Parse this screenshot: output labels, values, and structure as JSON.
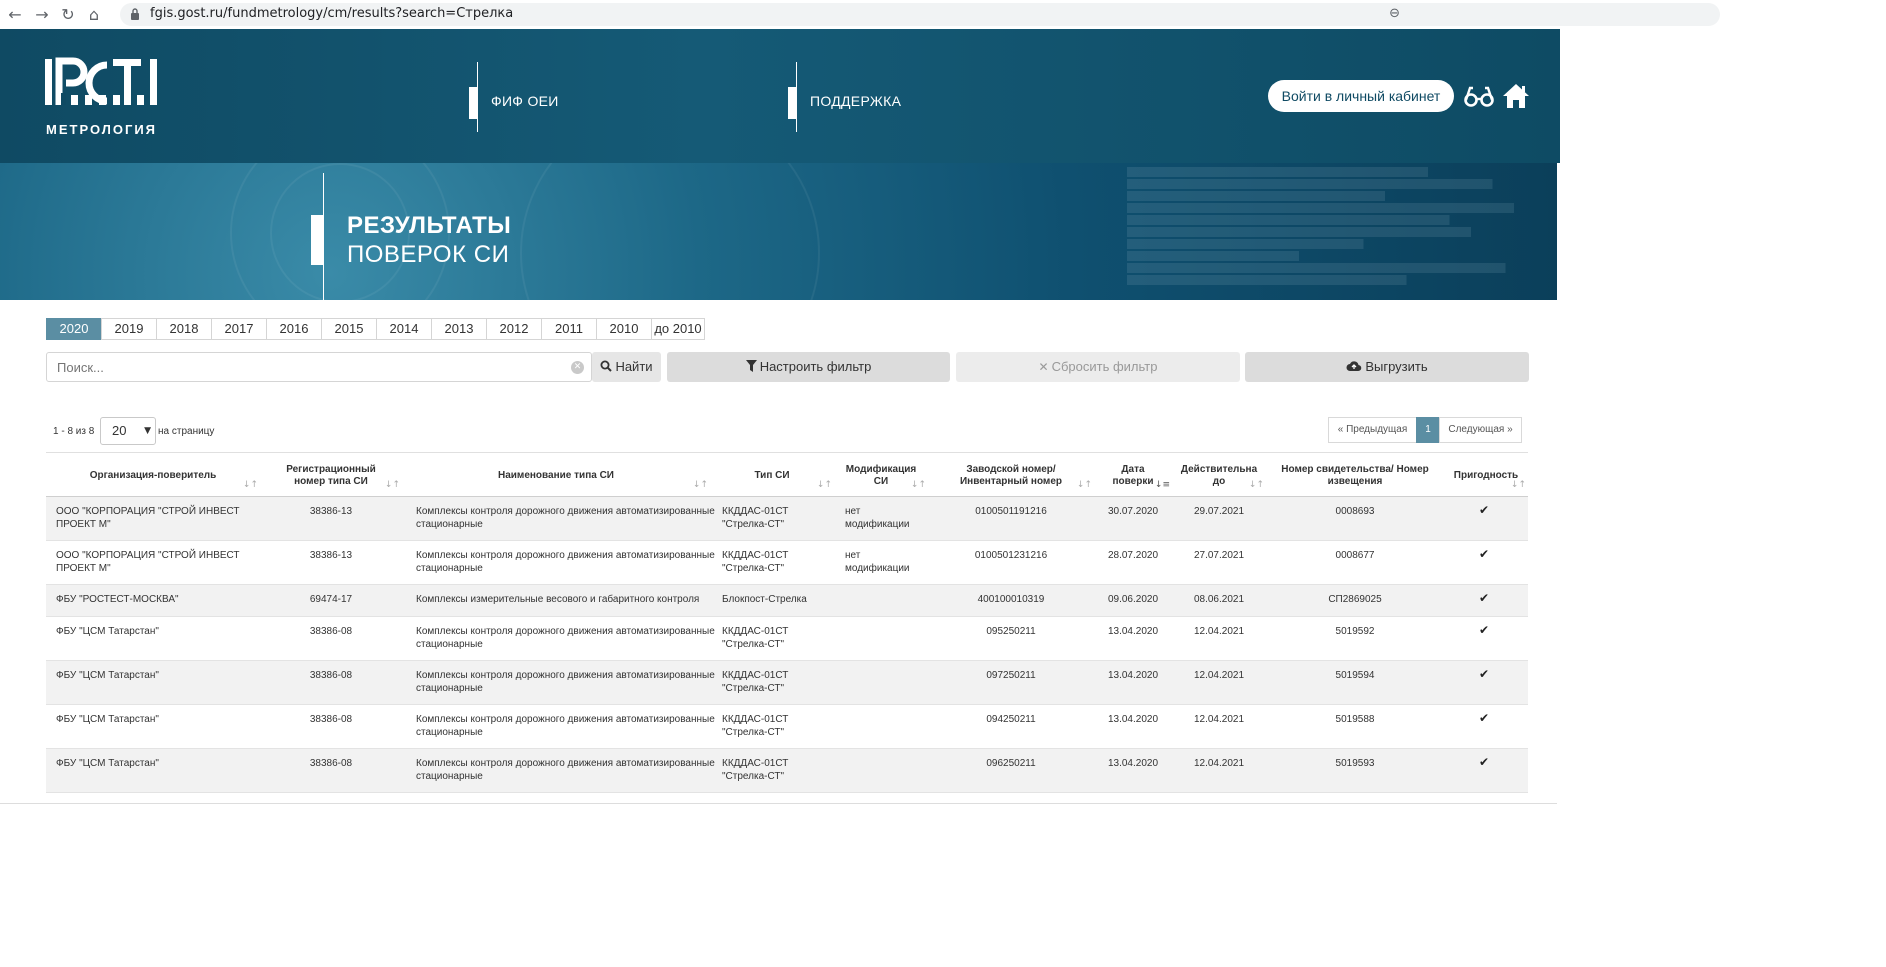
{
  "browser": {
    "url_text": "fgis.gost.ru/fundmetrology/cm/results?search=Стрелка",
    "back_glyph": "←",
    "forward_glyph": "→",
    "reload_glyph": "↻",
    "home_glyph": "⌂",
    "zoom_glyph": "⊖"
  },
  "header": {
    "logo_text": "МЕТРОЛОГИЯ",
    "menu": [
      "ФИФ ОЕИ",
      "ПОДДЕРЖКА"
    ],
    "login_label": "Войти в личный кабинет"
  },
  "banner": {
    "title": "РЕЗУЛЬТАТЫ",
    "subtitle": "ПОВЕРОК СИ"
  },
  "years": {
    "active": "2020",
    "items": [
      "2020",
      "2019",
      "2018",
      "2017",
      "2016",
      "2015",
      "2014",
      "2013",
      "2012",
      "2011",
      "2010",
      "до 2010"
    ]
  },
  "search": {
    "placeholder": "Поиск...",
    "find_label": "Найти",
    "filter_label": "Настроить фильтр",
    "reset_label": "Сбросить фильтр",
    "export_label": "Выгрузить"
  },
  "paging": {
    "range_text": "1 - 8 из 8",
    "per_page_value": "20",
    "per_page_label": "на страницу",
    "prev_label": "« Предыдущая",
    "current_page": "1",
    "next_label": "Следующая »"
  },
  "table": {
    "columns": [
      "Организация-поверитель",
      "Регистрационный номер типа СИ",
      "Наименование типа СИ",
      "Тип СИ",
      "Модификация СИ",
      "Заводской номер/ Инвентарный номер",
      "Дата поверки",
      "Действительна до",
      "Номер свидетельства/ Номер извещения",
      "Пригодность"
    ],
    "rows": [
      {
        "org": "ООО \"КОРПОРАЦИЯ \"СТРОЙ ИНВЕСТ ПРОЕКТ М\"",
        "reg": "38386-13",
        "name": "Комплексы контроля дорожного движения автоматизированные стационарные",
        "type": "ККДДАС-01СТ \"Стрелка-СТ\"",
        "mod": "нет модификации",
        "serial": "0100501191216",
        "date": "30.07.2020",
        "valid": "29.07.2021",
        "cert": "0008693",
        "ok": "✔"
      },
      {
        "org": "ООО \"КОРПОРАЦИЯ \"СТРОЙ ИНВЕСТ ПРОЕКТ М\"",
        "reg": "38386-13",
        "name": "Комплексы контроля дорожного движения автоматизированные стационарные",
        "type": "ККДДАС-01СТ \"Стрелка-СТ\"",
        "mod": "нет модификации",
        "serial": "0100501231216",
        "date": "28.07.2020",
        "valid": "27.07.2021",
        "cert": "0008677",
        "ok": "✔"
      },
      {
        "org": "ФБУ \"РОСТЕСТ-МОСКВА\"",
        "reg": "69474-17",
        "name": "Комплексы измерительные весового и габаритного контроля",
        "type": "Блокпост-Стрелка",
        "mod": "",
        "serial": "400100010319",
        "date": "09.06.2020",
        "valid": "08.06.2021",
        "cert": "СП2869025",
        "ok": "✔"
      },
      {
        "org": "ФБУ \"ЦСМ Татарстан\"",
        "reg": "38386-08",
        "name": "Комплексы контроля дорожного движения автоматизированные стационарные",
        "type": "ККДДАС-01СТ \"Стрелка-СТ\"",
        "mod": "",
        "serial": "095250211",
        "date": "13.04.2020",
        "valid": "12.04.2021",
        "cert": "5019592",
        "ok": "✔"
      },
      {
        "org": "ФБУ \"ЦСМ Татарстан\"",
        "reg": "38386-08",
        "name": "Комплексы контроля дорожного движения автоматизированные стационарные",
        "type": "ККДДАС-01СТ \"Стрелка-СТ\"",
        "mod": "",
        "serial": "097250211",
        "date": "13.04.2020",
        "valid": "12.04.2021",
        "cert": "5019594",
        "ok": "✔"
      },
      {
        "org": "ФБУ \"ЦСМ Татарстан\"",
        "reg": "38386-08",
        "name": "Комплексы контроля дорожного движения автоматизированные стационарные",
        "type": "ККДДАС-01СТ \"Стрелка-СТ\"",
        "mod": "",
        "serial": "094250211",
        "date": "13.04.2020",
        "valid": "12.04.2021",
        "cert": "5019588",
        "ok": "✔"
      },
      {
        "org": "ФБУ \"ЦСМ Татарстан\"",
        "reg": "38386-08",
        "name": "Комплексы контроля дорожного движения автоматизированные стационарные",
        "type": "ККДДАС-01СТ \"Стрелка-СТ\"",
        "mod": "",
        "serial": "096250211",
        "date": "13.04.2020",
        "valid": "12.04.2021",
        "cert": "5019593",
        "ok": "✔"
      }
    ]
  }
}
